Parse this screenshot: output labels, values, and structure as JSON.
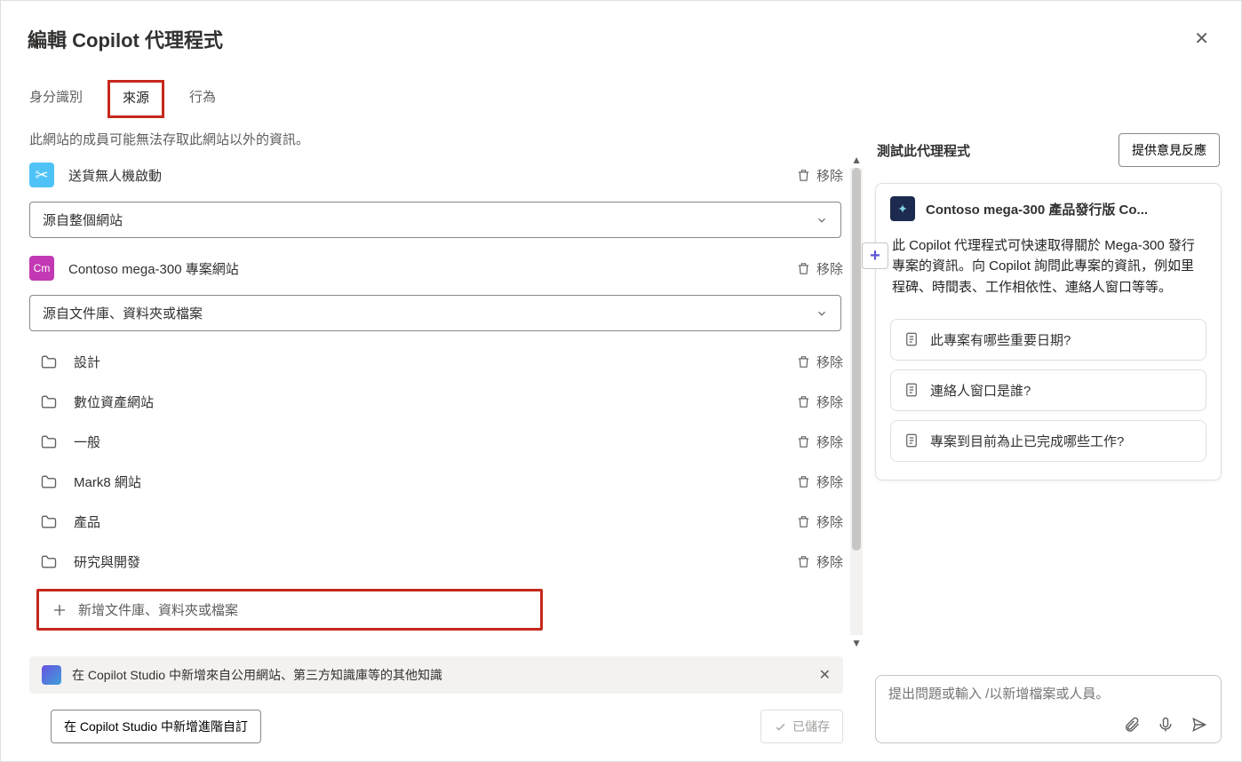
{
  "header": {
    "title": "編輯 Copilot 代理程式",
    "close": "✕"
  },
  "tabs": {
    "identity": "身分識別",
    "source": "來源",
    "behavior": "行為"
  },
  "note": "此網站的成員可能無法存取此網站以外的資訊。",
  "sources": {
    "remove_label": "移除",
    "drone": {
      "label": "送貨無人機啟動"
    },
    "dropdown1": "源自整個網站",
    "cm": {
      "icon_text": "Cm",
      "label": "Contoso mega-300 專案網站"
    },
    "dropdown2": "源自文件庫、資料夾或檔案"
  },
  "folders": [
    {
      "label": "設計"
    },
    {
      "label": "數位資產網站"
    },
    {
      "label": "一般"
    },
    {
      "label": "Mark8 網站"
    },
    {
      "label": "產品"
    },
    {
      "label": "研究與開發"
    }
  ],
  "add_button": "新增文件庫、資料夾或檔案",
  "banner": {
    "text": "在 Copilot Studio 中新增來自公用網站、第三方知識庫等的其他知識"
  },
  "bottom": {
    "advanced": "在 Copilot Studio 中新增進階自訂",
    "saved": "已儲存"
  },
  "right": {
    "test_label": "測試此代理程式",
    "feedback": "提供意見反應",
    "agent_title": "Contoso mega-300 產品發行版 Co...",
    "agent_desc": "此 Copilot 代理程式可快速取得關於 Mega-300 發行專案的資訊。向 Copilot 詢問此專案的資訊，例如里程碑、時間表、工作相依性、連絡人窗口等等。",
    "suggestions": [
      "此專案有哪些重要日期?",
      "連絡人窗口是誰?",
      "專案到目前為止已完成哪些工作?"
    ],
    "input_placeholder": "提出問題或輸入 /以新增檔案或人員。"
  }
}
